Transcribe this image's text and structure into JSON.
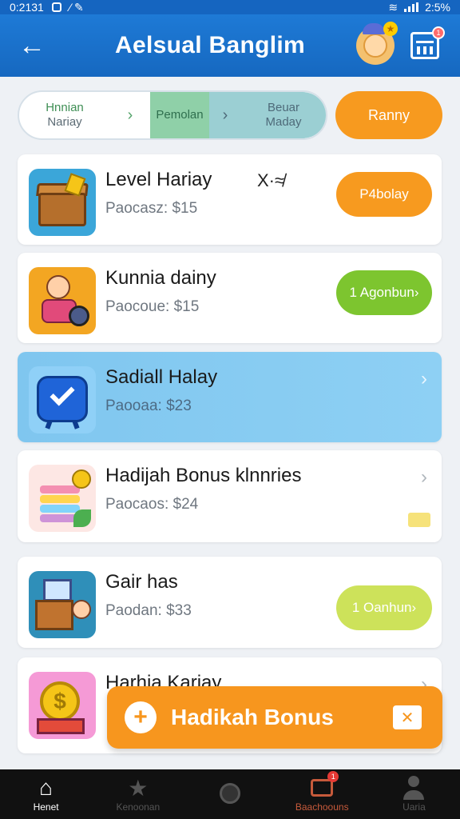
{
  "status_bar": {
    "time": "0:2131",
    "clock": "2:5%"
  },
  "header": {
    "title": "Aelsual Banglim",
    "back_icon": "arrow-left-icon",
    "notification_badge": "1"
  },
  "stepper": {
    "step1_top": "Hnnian",
    "step1_bottom": "Nariay",
    "step2": "Pemolan",
    "step3_top": "Beuar",
    "step3_bottom": "Maday",
    "ranking_label": "Ranny"
  },
  "items": [
    {
      "title": "Level Hariay",
      "sub_label": "Paocasz:",
      "price": "$15",
      "action": "P4bolay",
      "action_color": "#f79a1f",
      "icon": "treasure-chest-icon",
      "mini": "X·≉"
    },
    {
      "title": "Kunnia dainy",
      "sub_label": "Paocoue:",
      "price": "$15",
      "action": "1 Agonbun›",
      "action_color": "#7dc52f",
      "icon": "kid-icon"
    },
    {
      "title": "Sadiall Halay",
      "sub_label": "Paooaa:",
      "price": "$23",
      "icon": "shield-check-icon",
      "selected": true
    },
    {
      "title": "Hadijah Bonus klnnries",
      "sub_label": "Paocaos:",
      "price": "$24",
      "icon": "cake-icon"
    },
    {
      "title": "Gair has",
      "sub_label": "Paodan:",
      "price": "$33",
      "action": "1 Oanhun›",
      "action_color": "#cde25a",
      "icon": "gift-box-icon"
    },
    {
      "title": "Harhia Kariay",
      "icon": "coin-icon"
    }
  ],
  "bonus_button": {
    "label": "Hadikah Bonus",
    "close": "✕"
  },
  "bottom_nav": [
    {
      "label": "Henet",
      "icon": "home-icon"
    },
    {
      "label": "Kenoonan",
      "icon": "star-icon"
    },
    {
      "label": "",
      "icon": "dial-icon"
    },
    {
      "label": "Baachoouns",
      "icon": "wallet-icon",
      "badge": "1"
    },
    {
      "label": "Uaria",
      "icon": "person-icon"
    }
  ]
}
